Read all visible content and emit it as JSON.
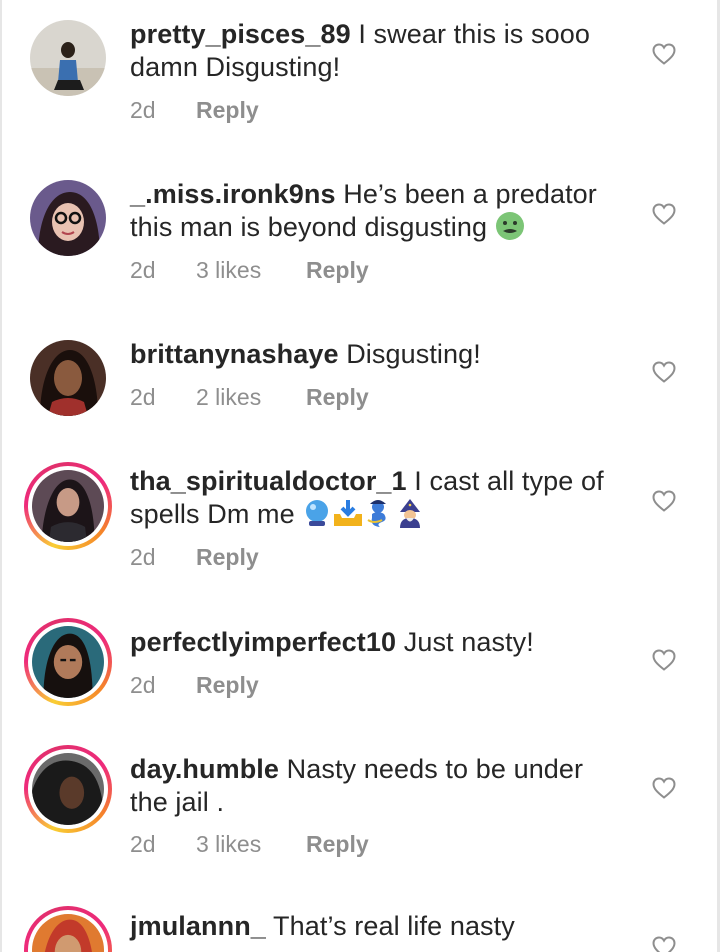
{
  "comments": [
    {
      "username": "pretty_pisces_89",
      "text_line1": "I swear this is sooo",
      "text_line2": "damn Disgusting!",
      "time": "2d",
      "likes": "",
      "reply": "Reply",
      "avatar": "avatar-icon"
    },
    {
      "username": "_.miss.ironk9ns",
      "text_line1": "He’s been a predator",
      "text_line2": "this man is beyond disgusting",
      "time": "2d",
      "likes": "3 likes",
      "reply": "Reply",
      "avatar": "avatar-icon",
      "emoji": "nauseated-face-icon"
    },
    {
      "username": "brittanynashaye",
      "text_line1": "Disgusting!",
      "text_line2": "",
      "time": "2d",
      "likes": "2 likes",
      "reply": "Reply",
      "avatar": "avatar-icon"
    },
    {
      "username": "tha_spiritualdoctor_1",
      "text_line1": "I cast all type of",
      "text_line2": "spells Dm me",
      "time": "2d",
      "likes": "",
      "reply": "Reply",
      "avatar": "avatar-icon",
      "emojis": [
        "crystal-ball-icon",
        "inbox-tray-icon",
        "genie-icon",
        "mage-icon"
      ]
    },
    {
      "username": "perfectlyimperfect10",
      "text_line1": "Just nasty!",
      "text_line2": "",
      "time": "2d",
      "likes": "",
      "reply": "Reply",
      "avatar": "avatar-icon"
    },
    {
      "username": "day.humble",
      "text_line1": "Nasty needs to be under",
      "text_line2": "the jail .",
      "time": "2d",
      "likes": "3 likes",
      "reply": "Reply",
      "avatar": "avatar-icon"
    },
    {
      "username": "jmulannn_",
      "text_line1": "That’s real life nasty",
      "text_line2": "",
      "time": "",
      "likes": "",
      "reply": "",
      "avatar": "avatar-icon"
    }
  ],
  "icons": {
    "like": "heart-outline-icon"
  },
  "colors": {
    "text": "#262626",
    "meta": "#8e8e8e",
    "story_ring": "#ee2a7b"
  }
}
